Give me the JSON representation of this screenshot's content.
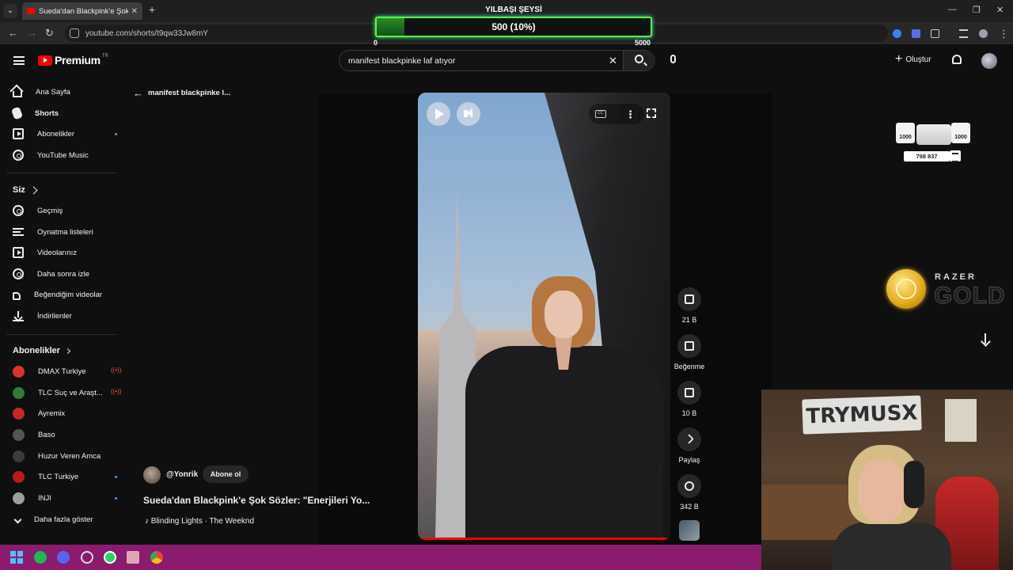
{
  "browser": {
    "tab_title": "Sueda'dan Blackpink'e Şok Sözler",
    "url": "youtube.com/shorts/t9qw33Jw8mY"
  },
  "overlay": {
    "title": "YILBAŞI ŞEYSİ",
    "progress_text": "500 (10%)",
    "progress_fraction": 0.1,
    "min": "0",
    "max": "5000",
    "accent": "#54ff3a"
  },
  "header": {
    "logo_word": "Premium",
    "logo_region": "TR",
    "search_query": "manifest blackpinke laf atıyor",
    "create_label": "Oluştur"
  },
  "sidebar": {
    "main": [
      {
        "label": "Ana Sayfa",
        "icon": "home-icon"
      },
      {
        "label": "Shorts",
        "icon": "shorts-icon"
      },
      {
        "label": "Abonelikler",
        "icon": "subscriptions-icon"
      },
      {
        "label": "YouTube Music",
        "icon": "music-icon"
      }
    ],
    "you_heading": "Siz",
    "you": [
      {
        "label": "Geçmiş",
        "icon": "history-icon"
      },
      {
        "label": "Oynatma listeleri",
        "icon": "playlists-icon"
      },
      {
        "label": "Videolarınız",
        "icon": "your-videos-icon"
      },
      {
        "label": "Daha sonra izle",
        "icon": "watch-later-icon"
      },
      {
        "label": "Beğendiğim videolar",
        "icon": "liked-icon"
      },
      {
        "label": "İndirilenler",
        "icon": "downloads-icon"
      }
    ],
    "subs_heading": "Abonelikler",
    "subs": [
      {
        "label": "DMAX Turkiye",
        "color": "#d9342b",
        "live": true
      },
      {
        "label": "TLC Suç ve Araşt...",
        "color": "#2e7d32",
        "live": true
      },
      {
        "label": "Ayremix",
        "color": "#c62828",
        "live": false
      },
      {
        "label": "Baso",
        "color": "#555555",
        "live": false
      },
      {
        "label": "Huzur Veren Amca",
        "color": "#3c3c3c",
        "live": false
      },
      {
        "label": "TLC Turkiye",
        "color": "#b71c1c",
        "live": false
      },
      {
        "label": "INJI",
        "color": "#9e9e9e",
        "live": false
      }
    ],
    "show_more": "Daha fazla göster"
  },
  "shorts": {
    "back_title": "manifest blackpinke l...",
    "actions": {
      "like_count": "21 B",
      "dislike_label": "Beğenme",
      "comments_count": "10 B",
      "share_label": "Paylaş",
      "remix_count": "342 B"
    },
    "channel": "@Yonrik",
    "subscribe": "Abone ol",
    "title": "Sueda'dan Blackpink'e Şok Sözler: \"Enerjileri Yo...",
    "music": "♪ Blinding Lights · The Weeknd",
    "progress_color": "#ff0000"
  },
  "widgets": {
    "box_left": "1000",
    "box_right": "1000",
    "count": "798 837",
    "razer": "RAZER",
    "gold": "GOLD"
  },
  "webcam": {
    "sign": "TRYMUSX"
  }
}
